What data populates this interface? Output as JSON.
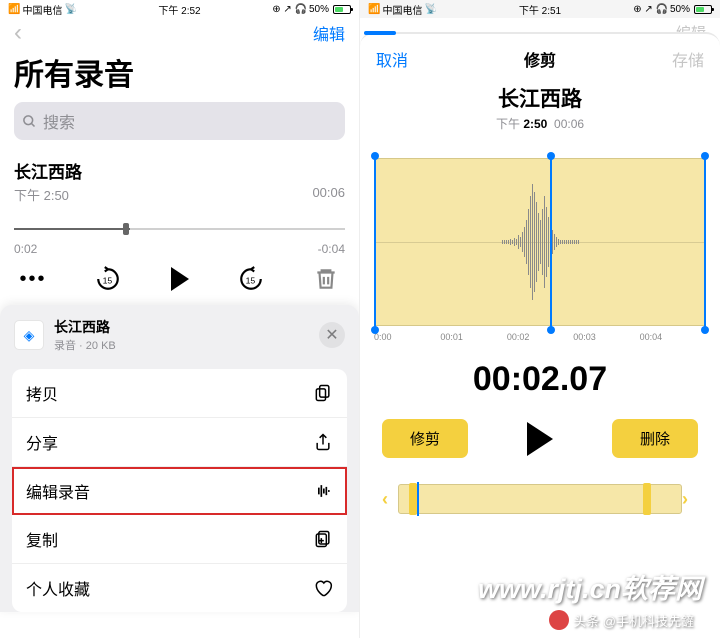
{
  "left": {
    "status": {
      "carrier": "中国电信",
      "time": "下午 2:52",
      "battery": "50%"
    },
    "nav": {
      "edit": "编辑"
    },
    "title": "所有录音",
    "search_placeholder": "搜索",
    "recording": {
      "title": "长江西路",
      "time": "下午 2:50",
      "duration": "00:06"
    },
    "scrubber": {
      "elapsed": "0:02",
      "remaining": "-0:04"
    },
    "sheet": {
      "title": "长江西路",
      "subtitle": "录音 · 20 KB",
      "actions": {
        "copy": "拷贝",
        "share": "分享",
        "edit": "编辑录音",
        "duplicate": "复制",
        "favorite": "个人收藏"
      }
    }
  },
  "right": {
    "status": {
      "carrier": "中国电信",
      "time": "下午 2:51",
      "battery": "50%"
    },
    "dim_edit": "编辑",
    "nav": {
      "cancel": "取消",
      "title": "修剪",
      "save": "存储"
    },
    "rec": {
      "title": "长江西路",
      "time_prefix": "下午",
      "time_bold": "2:50",
      "duration": "00:06"
    },
    "ruler": [
      "0:00",
      "00:01",
      "00:02",
      "00:03",
      "00:04"
    ],
    "timecode": "00:02.07",
    "buttons": {
      "trim": "修剪",
      "delete": "删除"
    }
  },
  "watermark": {
    "url": "www.rjtj.cn软荐网",
    "byline": "头条 @手机科技先鏟"
  }
}
